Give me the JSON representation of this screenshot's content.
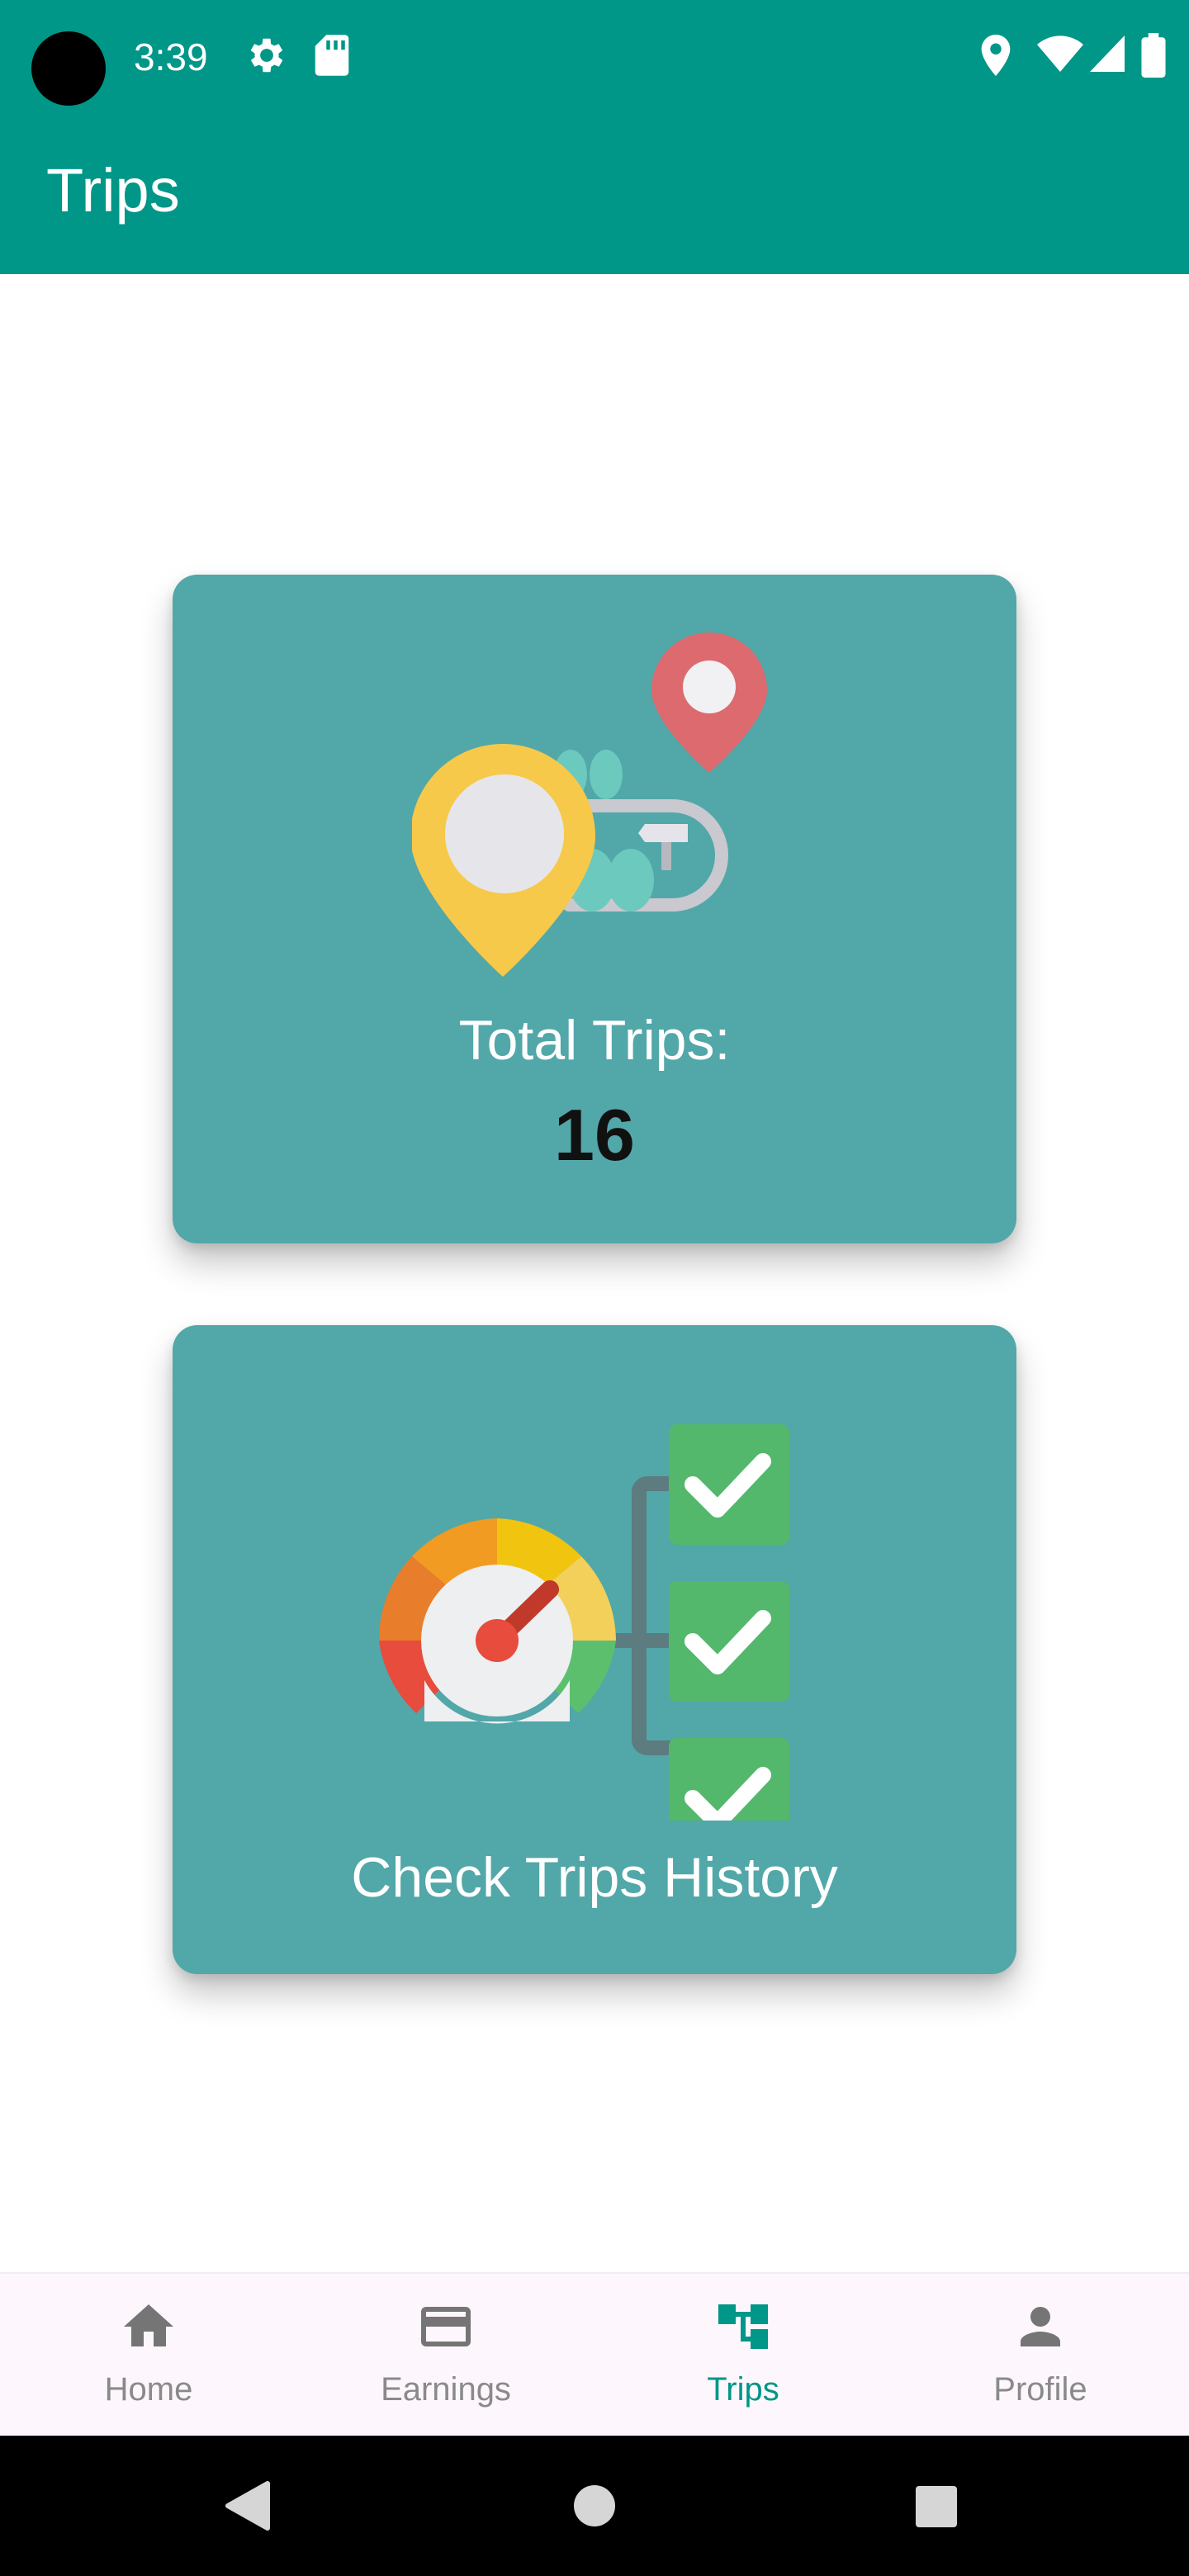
{
  "status_bar": {
    "time": "3:39",
    "icons_left": [
      "gear-icon",
      "sd-card-icon"
    ],
    "icons_right": [
      "location-icon",
      "wifi-icon",
      "signal-icon",
      "battery-icon"
    ]
  },
  "app_bar": {
    "title": "Trips"
  },
  "cards": {
    "total_trips": {
      "label": "Total Trips:",
      "value": "16",
      "illustration": "map-route-illustration"
    },
    "history": {
      "label": "Check Trips History",
      "illustration": "speedometer-checklist-illustration"
    }
  },
  "bottom_nav": {
    "items": [
      {
        "label": "Home",
        "icon": "home-icon"
      },
      {
        "label": "Earnings",
        "icon": "card-icon"
      },
      {
        "label": "Trips",
        "icon": "trips-icon",
        "active": true
      },
      {
        "label": "Profile",
        "icon": "person-icon"
      }
    ]
  },
  "colors": {
    "primary": "#009688",
    "card": "#52a7a9",
    "nav_background": "#fdf7fd",
    "inactive": "#8a8a8a"
  }
}
